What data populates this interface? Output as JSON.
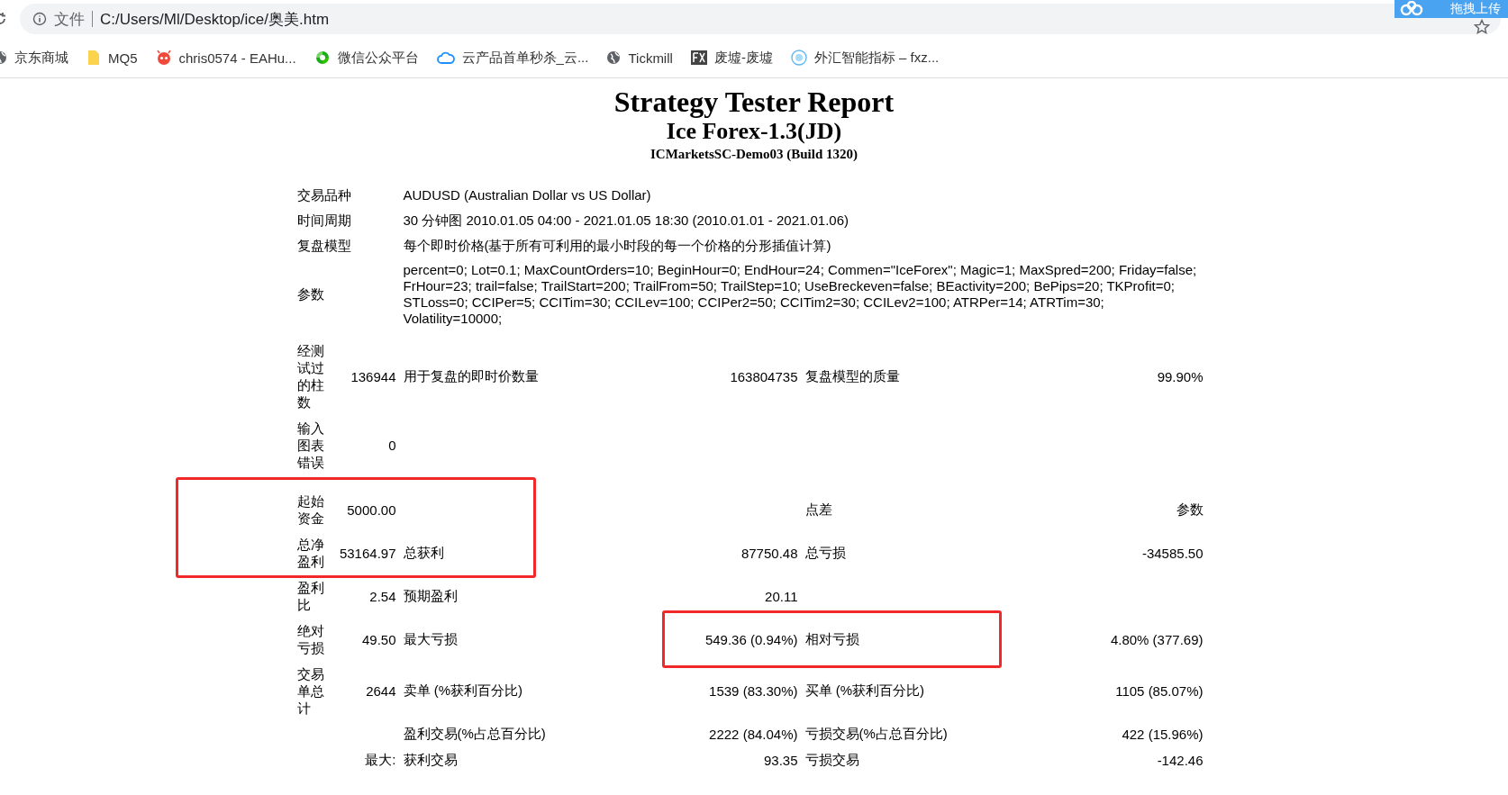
{
  "browser": {
    "address_prefix": "文件",
    "address": "C:/Users/Ml/Desktop/ice/奥美.htm",
    "upload_widget": "拖拽上传"
  },
  "bookmarks": [
    {
      "label": "京东商城",
      "kind": "globe"
    },
    {
      "label": "MQ5",
      "kind": "folder"
    },
    {
      "label": "chris0574 - EAHu...",
      "kind": "robot"
    },
    {
      "label": "微信公众平台",
      "kind": "swirl"
    },
    {
      "label": "云产品首单秒杀_云...",
      "kind": "cloud"
    },
    {
      "label": "Tickmill",
      "kind": "globe"
    },
    {
      "label": "废墟-废墟",
      "kind": "fx"
    },
    {
      "label": "外汇智能指标 – fxz...",
      "kind": "ea"
    }
  ],
  "report": {
    "title": "Strategy Tester Report",
    "subtitle": "Ice Forex-1.3(JD)",
    "server": "ICMarketsSC-Demo03 (Build 1320)",
    "info": [
      {
        "label": "交易品种",
        "lines": [
          "AUDUSD (Australian Dollar vs US Dollar)"
        ]
      },
      {
        "label": "时间周期",
        "lines": [
          "30 分钟图 2010.01.05 04:00 - 2021.01.05 18:30 (2010.01.01 - 2021.01.06)"
        ]
      },
      {
        "label": "复盘模型",
        "lines": [
          "每个即时价格(基于所有可利用的最小时段的每一个价格的分形插值计算)"
        ]
      },
      {
        "label": "参数",
        "lines": [
          "percent=0; Lot=0.1; MaxCountOrders=10; BeginHour=0; EndHour=24; Commen=\"IceForex\"; Magic=1; MaxSpred=200; Friday=false;",
          "FrHour=23; trail=false; TrailStart=200; TrailFrom=50; TrailStep=10; UseBreckeven=false; BEactivity=200; BePips=20; TKProfit=0;",
          "STLoss=0; CCIPer=5; CCITim=30; CCILev=100; CCIPer2=50; CCITim2=30; CCILev2=100; ATRPer=14; ATRTim=30;",
          "Volatility=10000;"
        ]
      }
    ],
    "stats": [
      {
        "kind": "row",
        "label": "经测试过的柱数",
        "value": "136944",
        "middle": {
          "label": "用于复盘的即时价数量",
          "value": "163804735"
        },
        "right": {
          "label": "复盘模型的质量",
          "value": "99.90%"
        }
      },
      {
        "kind": "row",
        "label": "输入图表错误",
        "value": "0"
      },
      {
        "kind": "group",
        "framed": true,
        "rows": [
          {
            "kind": "row",
            "label": "起始资金",
            "value": "5000.00",
            "right": {
              "label": "点差",
              "value": "参数"
            }
          },
          {
            "kind": "row",
            "label": "总净盈利",
            "value": "53164.97",
            "middle": {
              "label": "总获利",
              "value": "87750.48"
            },
            "right": {
              "label": "总亏损",
              "value": "-34585.50"
            }
          }
        ]
      },
      {
        "kind": "row",
        "label": "盈利比",
        "value": "2.54",
        "middle": {
          "label": "预期盈利",
          "value": "20.11"
        }
      },
      {
        "kind": "row",
        "label": "绝对亏损",
        "value": "49.50",
        "framed": true,
        "middle": {
          "label": "最大亏损",
          "value": "549.36 (0.94%)"
        },
        "right": {
          "label": "相对亏损",
          "value": "4.80% (377.69)"
        }
      },
      {
        "kind": "row",
        "label": "交易单总计",
        "value": "2644",
        "middle": {
          "label": "卖单 (%获利百分比)",
          "value": "1539 (83.30%)"
        },
        "right": {
          "label": "买单 (%获利百分比)",
          "value": "1105 (85.07%)"
        }
      },
      {
        "kind": "row",
        "middle": {
          "label": "盈利交易(%占总百分比)",
          "value": "2222 (84.04%)"
        },
        "right": {
          "label": "亏损交易(%占总百分比)",
          "value": "422 (15.96%)"
        }
      },
      {
        "kind": "row",
        "value": "最大:",
        "middle": {
          "label": "获利交易",
          "value": "93.35"
        },
        "right": {
          "label": "亏损交易",
          "value": "-142.46"
        }
      }
    ]
  }
}
